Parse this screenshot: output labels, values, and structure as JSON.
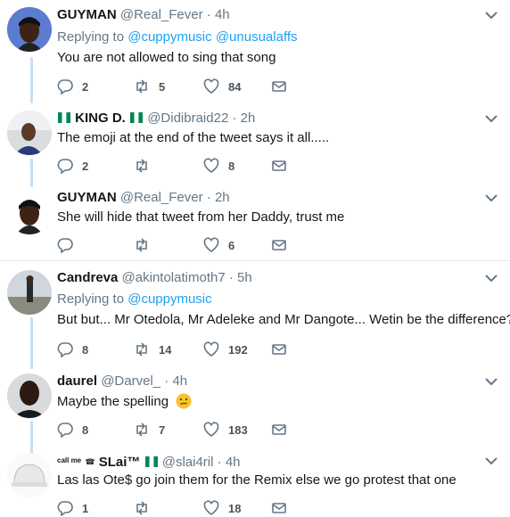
{
  "tweets": [
    {
      "name": "GUYMAN",
      "handle": "@Real_Fever",
      "time": "4h",
      "reply_prefix": "Replying to",
      "reply_targets": [
        "@cuppymusic",
        "@unusualaffs"
      ],
      "text": "You are not allowed to sing that song",
      "replies": "2",
      "retweets": "5",
      "likes": "84"
    },
    {
      "name": "KING D.",
      "handle": "@Didibraid22",
      "time": "2h",
      "text": "The emoji at the end of the tweet says it all.....",
      "replies": "2",
      "retweets": "",
      "likes": "8"
    },
    {
      "name": "GUYMAN",
      "handle": "@Real_Fever",
      "time": "2h",
      "text": "She will hide that tweet from her Daddy, trust me",
      "replies": "",
      "retweets": "",
      "likes": "6"
    },
    {
      "name": "Candreva",
      "handle": "@akintolatimoth7",
      "time": "5h",
      "reply_prefix": "Replying to",
      "reply_targets": [
        "@cuppymusic"
      ],
      "text": "But but... Mr Otedola, Mr Adeleke and Mr Dangote... Wetin be the difference?",
      "replies": "8",
      "retweets": "14",
      "likes": "192"
    },
    {
      "name": "daurel",
      "handle": "@Darvel_",
      "time": "4h",
      "text": "Maybe the spelling",
      "replies": "8",
      "retweets": "7",
      "likes": "183"
    },
    {
      "name_prefix": "call me",
      "name": "SLai™",
      "handle": "@slai4ril",
      "time": "4h",
      "text": "Las las Ote$ go join them for the Remix else we go protest that one",
      "replies": "1",
      "retweets": "",
      "likes": "18"
    }
  ],
  "separator": "·",
  "colors": {
    "link": "#1da1f2",
    "muted": "#657786",
    "thread": "#c4e0f5",
    "flag_green": "#008751"
  },
  "icons": [
    "reply-icon",
    "retweet-icon",
    "like-icon",
    "direct-message-icon",
    "chevron-down-icon"
  ]
}
